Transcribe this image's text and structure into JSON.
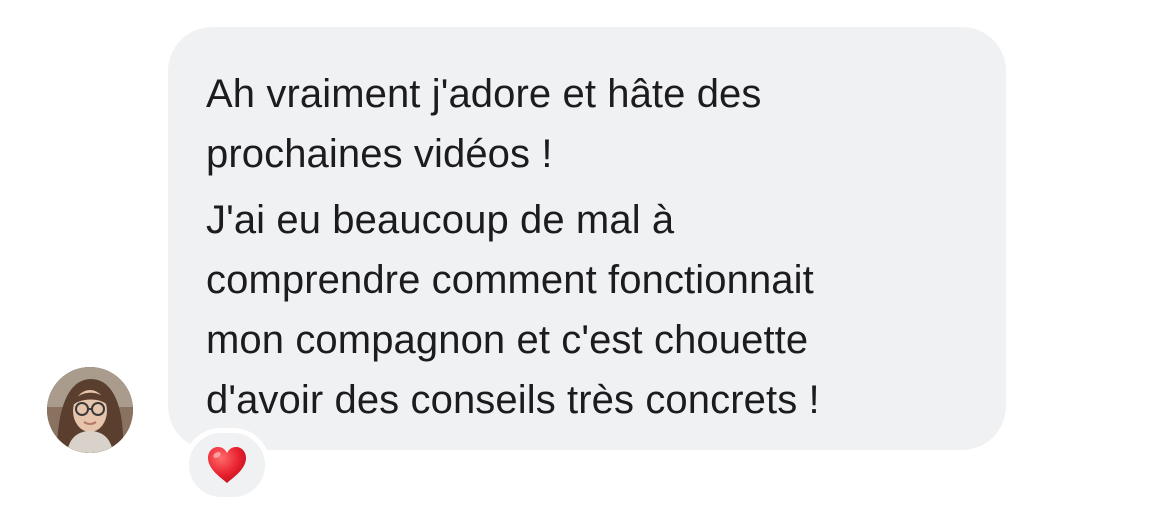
{
  "message": {
    "paragraphs": [
      "Ah vraiment j'adore et hâte des\nprochaines vidéos !",
      "J'ai eu beaucoup de mal à\ncomprendre comment fonctionnait\nmon compagnon et c'est chouette\nd'avoir des conseils très concrets !"
    ],
    "bubble_color": "#f0f1f3",
    "text_color": "#1c1c1e"
  },
  "reaction": {
    "icon": "heart-icon",
    "color": "#e8202e"
  },
  "sender": {
    "avatar_icon": "avatar"
  }
}
